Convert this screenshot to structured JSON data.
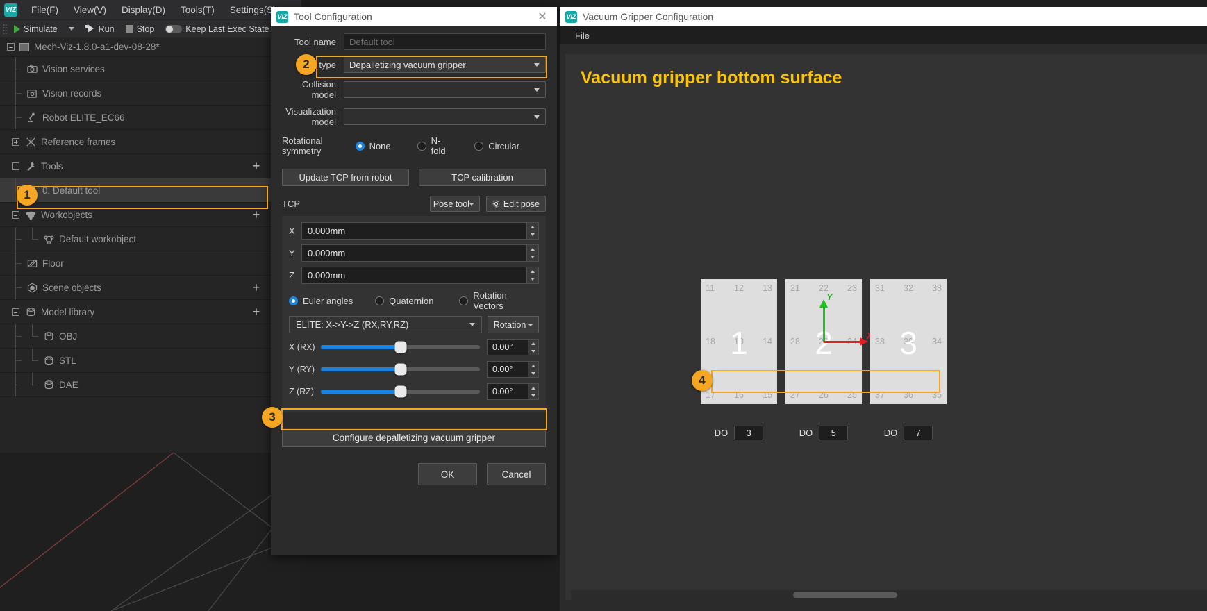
{
  "app": {
    "logo_text": "VIZ",
    "menubar": [
      "File(F)",
      "View(V)",
      "Display(D)",
      "Tools(T)",
      "Settings(S)"
    ],
    "toolbar": {
      "simulate": "Simulate",
      "run": "Run",
      "stop": "Stop",
      "keep_last_exec_state": "Keep Last Exec State"
    },
    "project_name": "Mech-Viz-1.8.0-a1-dev-08-28*"
  },
  "tree": [
    {
      "label": "Vision services",
      "icon": "camera-icon",
      "indent": 2,
      "toggle": "none",
      "action": "refresh"
    },
    {
      "label": "Vision records",
      "icon": "vision-record-icon",
      "indent": 2,
      "toggle": "none",
      "action": "none"
    },
    {
      "label": "Robot ELITE_EC66",
      "icon": "robot-icon",
      "indent": 2,
      "toggle": "none",
      "action": "eye"
    },
    {
      "label": "Reference frames",
      "icon": "frames-icon",
      "indent": 1,
      "toggle": "plus",
      "action": "none"
    },
    {
      "label": "Tools",
      "icon": "wrench-icon",
      "indent": 1,
      "toggle": "minus",
      "action": "add"
    },
    {
      "label": "0. Default tool",
      "icon": "wrench-icon",
      "indent": 2,
      "toggle": "none",
      "action": "eye",
      "selected": true
    },
    {
      "label": "Workobjects",
      "icon": "workobject-icon",
      "indent": 1,
      "toggle": "minus",
      "action": "add"
    },
    {
      "label": "Default workobject",
      "icon": "workobject-small-icon",
      "indent": 3,
      "toggle": "none",
      "action": "none"
    },
    {
      "label": "Floor",
      "icon": "floor-icon",
      "indent": 2,
      "toggle": "none",
      "action": "eye"
    },
    {
      "label": "Scene objects",
      "icon": "scene-object-icon",
      "indent": 2,
      "toggle": "none",
      "action": "add-eye"
    },
    {
      "label": "Model library",
      "icon": "model-library-icon",
      "indent": 1,
      "toggle": "minus",
      "action": "add"
    },
    {
      "label": "OBJ",
      "icon": "model-library-icon",
      "indent": 3,
      "toggle": "none",
      "action": "none"
    },
    {
      "label": "STL",
      "icon": "model-library-icon",
      "indent": 3,
      "toggle": "none",
      "action": "none"
    },
    {
      "label": "DAE",
      "icon": "model-library-icon",
      "indent": 3,
      "toggle": "none",
      "action": "none"
    }
  ],
  "tool_dialog": {
    "title": "Tool Configuration",
    "fields": {
      "tool_name_label": "Tool name",
      "tool_name_placeholder": "Default tool",
      "tool_name_value": "",
      "tool_type_label": "Tool type",
      "tool_type_value": "Depalletizing vacuum gripper",
      "collision_model_label": "Collision model",
      "collision_model_value": "",
      "visualization_model_label": "Visualization model",
      "visualization_model_value": ""
    },
    "rotational_symmetry": {
      "label": "Rotational symmetry",
      "options": [
        "None",
        "N-fold",
        "Circular"
      ],
      "selected": "None"
    },
    "buttons": {
      "update_tcp": "Update TCP from robot",
      "tcp_calibration": "TCP calibration",
      "pose_tool": "Pose tool",
      "edit_pose": "Edit pose",
      "configure_gripper": "Configure depalletizing vacuum gripper",
      "ok": "OK",
      "cancel": "Cancel"
    },
    "tcp": {
      "label": "TCP",
      "axes": [
        {
          "label": "X",
          "value": "0.000mm"
        },
        {
          "label": "Y",
          "value": "0.000mm"
        },
        {
          "label": "Z",
          "value": "0.000mm"
        }
      ],
      "rotation_mode": {
        "options": [
          "Euler angles",
          "Quaternion",
          "Rotation Vectors"
        ],
        "selected": "Euler angles"
      },
      "convention": "ELITE: X->Y->Z (RX,RY,RZ)",
      "rotation_button": "Rotation",
      "rotations": [
        {
          "label": "X (RX)",
          "value": "0.00°",
          "percent": 50
        },
        {
          "label": "Y (RY)",
          "value": "0.00°",
          "percent": 50
        },
        {
          "label": "Z (RZ)",
          "value": "0.00°",
          "percent": 50
        }
      ]
    }
  },
  "vacuum_window": {
    "title": "Vacuum Gripper Configuration",
    "menu": [
      "File"
    ],
    "heading": "Vacuum gripper bottom surface",
    "axis_labels": {
      "x": "X",
      "y": "Y"
    },
    "pads": [
      {
        "number": "1",
        "corners": [
          "11",
          "12",
          "13",
          "18",
          "10",
          "14",
          "17",
          "16",
          "15"
        ]
      },
      {
        "number": "2",
        "corners": [
          "21",
          "22",
          "23",
          "28",
          "20",
          "24",
          "27",
          "26",
          "25"
        ]
      },
      {
        "number": "3",
        "corners": [
          "31",
          "32",
          "33",
          "38",
          "30",
          "34",
          "37",
          "36",
          "35"
        ]
      }
    ],
    "do_row": [
      {
        "label": "DO",
        "value": "3"
      },
      {
        "label": "DO",
        "value": "5"
      },
      {
        "label": "DO",
        "value": "7"
      }
    ]
  },
  "callouts": [
    {
      "number": "1"
    },
    {
      "number": "2"
    },
    {
      "number": "3"
    },
    {
      "number": "4"
    }
  ],
  "colors": {
    "accent_orange": "#f5a623",
    "heading_yellow": "#ffc400",
    "slider_blue": "#1b84e0",
    "axis_x_red": "#e02020",
    "axis_y_green": "#22c022",
    "logo_teal": "#17a8a8"
  }
}
